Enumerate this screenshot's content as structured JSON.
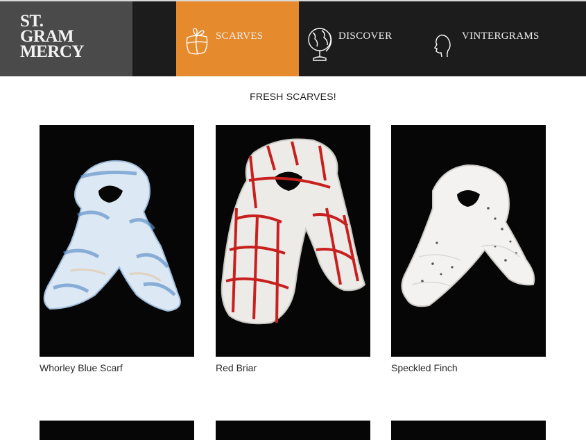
{
  "logo": {
    "lines": [
      "ST.",
      "GRAM",
      "MERCY"
    ]
  },
  "nav": {
    "items": [
      {
        "label": "SCARVES",
        "icon": "gift-icon",
        "active": true
      },
      {
        "label": "DISCOVER",
        "icon": "globe-icon",
        "active": false
      },
      {
        "label": "VINTERGRAMS",
        "icon": "profile-silhouette-icon",
        "active": false
      }
    ]
  },
  "main": {
    "title": "FRESH SCARVES!",
    "products": [
      {
        "name": "Whorley Blue Scarf",
        "image": "blue-tie-dye-scarf"
      },
      {
        "name": "Red Briar",
        "image": "red-plaid-scarf"
      },
      {
        "name": "Speckled Finch",
        "image": "white-speckled-scarf"
      }
    ]
  },
  "colors": {
    "header_bg": "#1c1c1c",
    "logo_bg": "#4a4a4a",
    "active_nav": "#e68a2e",
    "photo_bg": "#060606"
  }
}
